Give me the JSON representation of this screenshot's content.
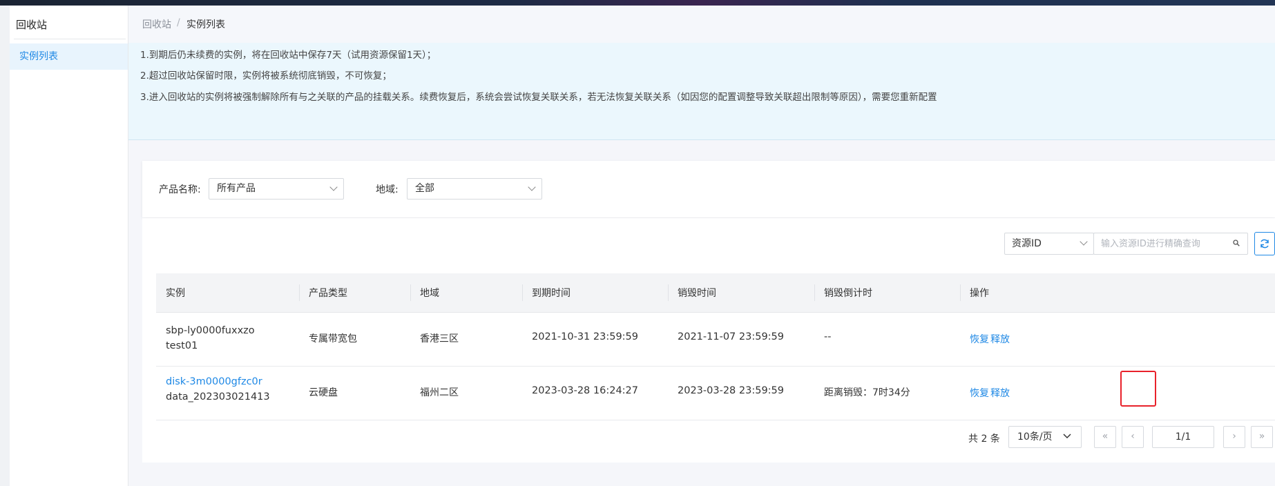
{
  "sidebar": {
    "title": "回收站",
    "items": [
      {
        "label": "实例列表",
        "active": true
      }
    ]
  },
  "breadcrumb": {
    "root": "回收站",
    "separator": "/",
    "current": "实例列表"
  },
  "notice": {
    "line1": "1.到期后仍未续费的实例，将在回收站中保存7天（试用资源保留1天）；",
    "line2": "2.超过回收站保留时限，实例将被系统彻底销毁，不可恢复；",
    "line3": "3.进入回收站的实例将被强制解除所有与之关联的产品的挂载关系。续费恢复后，系统会尝试恢复关联关系，若无法恢复关联关系（如因您的配置调整导致关联超出限制等原因），需要您重新配置"
  },
  "filters": {
    "product_label": "产品名称:",
    "product_value": "所有产品",
    "region_label": "地域:",
    "region_value": "全部"
  },
  "search": {
    "field_select": "资源ID",
    "placeholder": "输入资源ID进行精确查询"
  },
  "table": {
    "headers": [
      "实例",
      "产品类型",
      "地域",
      "到期时间",
      "销毁时间",
      "销毁倒计时",
      "操作"
    ],
    "rows": [
      {
        "instance_id": "sbp-ly0000fuxxzo",
        "instance_name": "test01",
        "product_type": "专属带宽包",
        "region": "香港三区",
        "expire_time": "2021-10-31 23:59:59",
        "destroy_time": "2021-11-07 23:59:59",
        "countdown": "--",
        "action_restore": "恢复",
        "action_release": "释放"
      },
      {
        "instance_id": "disk-3m0000gfzc0r",
        "instance_name": "data_202303021413",
        "product_type": "云硬盘",
        "region": "福州二区",
        "expire_time": "2023-03-28 16:24:27",
        "destroy_time": "2023-03-28 23:59:59",
        "countdown": "距离销毁：7时34分",
        "action_restore": "恢复",
        "action_release": "释放"
      }
    ]
  },
  "pagination": {
    "total": "共 2 条",
    "page_size": "10条/页",
    "page": "1/1",
    "first": "«",
    "prev": "‹",
    "next": "›",
    "last": "»"
  },
  "colors": {
    "accent": "#1e88e5",
    "highlight_box": "#e8212a",
    "notice_bg": "#ebf7fd"
  }
}
